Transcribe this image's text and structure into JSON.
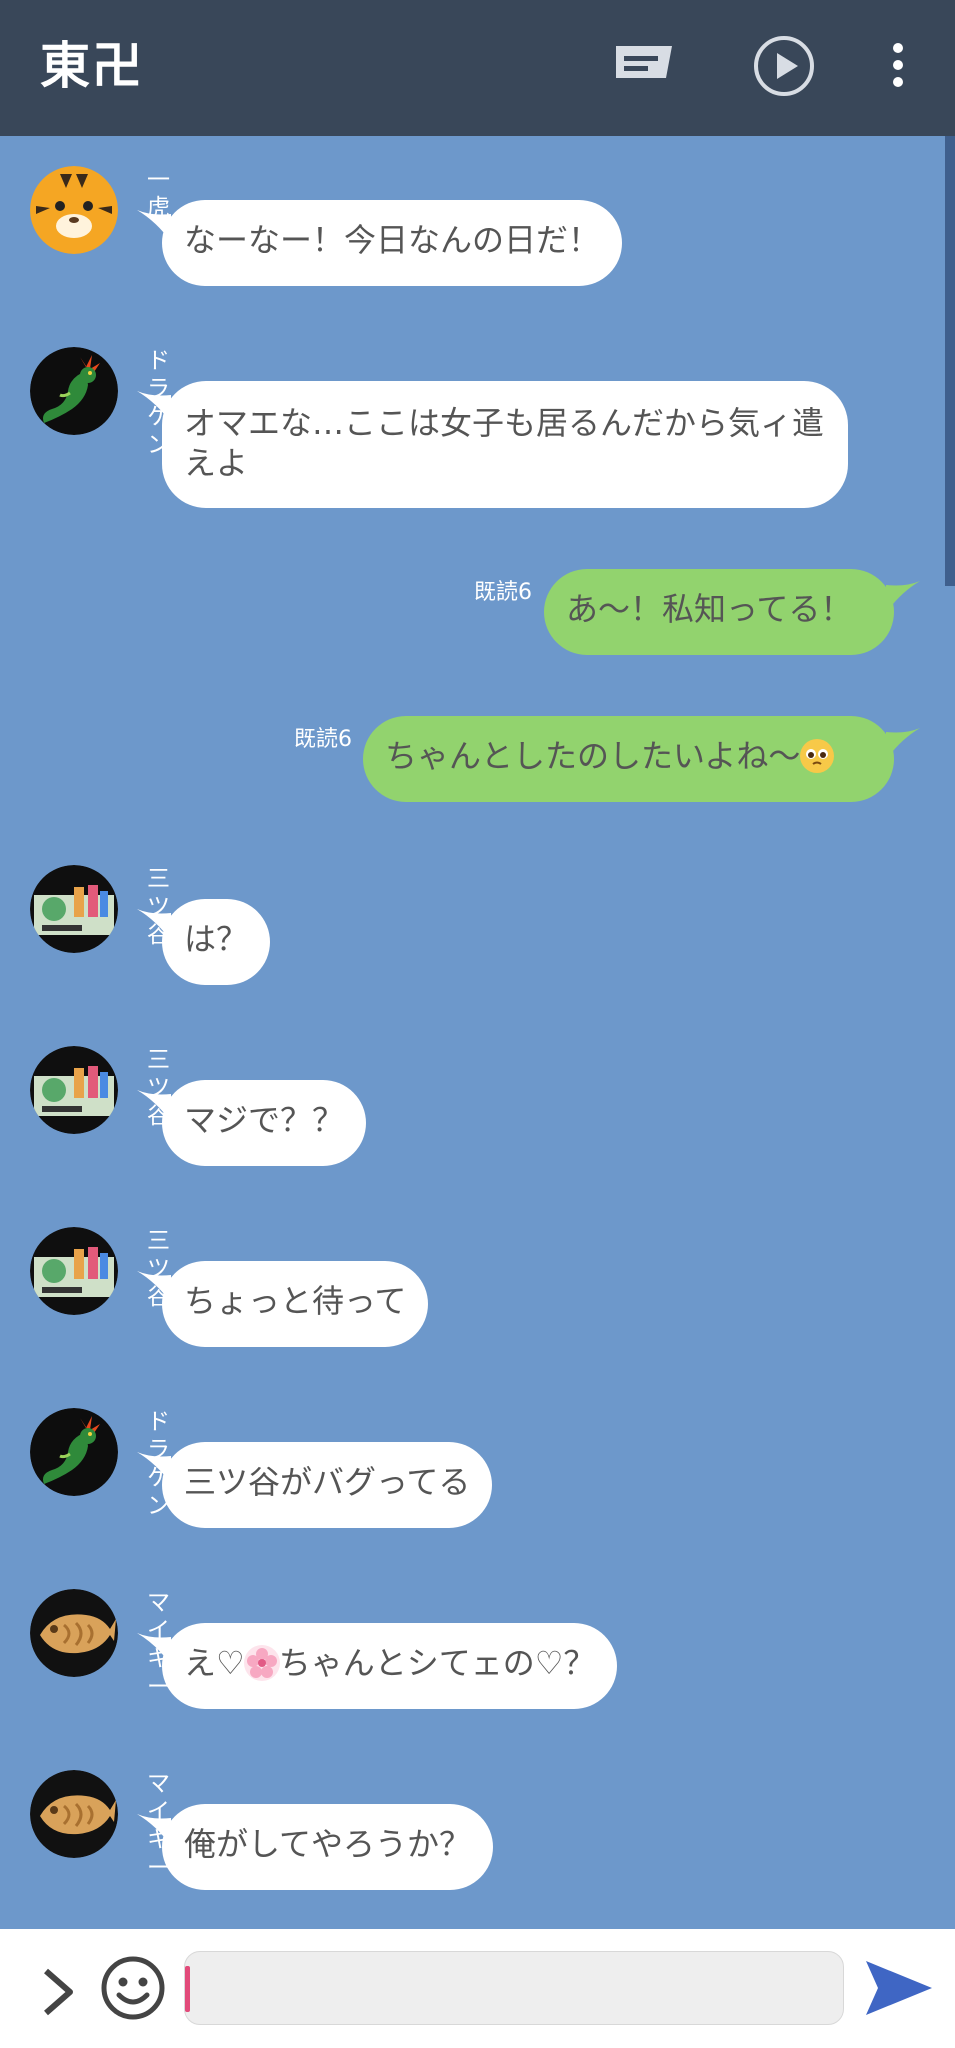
{
  "header": {
    "title": "東卍",
    "icons": [
      "notes-icon",
      "play-icon",
      "more-icon"
    ]
  },
  "messages": [
    {
      "sender": "一虎",
      "text": "なーなー！今日なんの日だ！",
      "avatar": "tiger-avatar"
    },
    {
      "sender": "ドラケン",
      "text": "オマエな…ここは女子も居るんだから気ィ遣えよ",
      "avatar": "dragon-avatar"
    },
    {
      "read": "既読6",
      "text": "あ〜！私知ってる！"
    },
    {
      "read": "既読6",
      "text": "ちゃんとしたのしたいよね〜",
      "emoji": "pleading-face-emoji"
    },
    {
      "sender": "三ツ谷",
      "text": "は？",
      "avatar": "sewing-avatar"
    },
    {
      "sender": "三ツ谷",
      "text": "マジで？？",
      "avatar": "sewing-avatar"
    },
    {
      "sender": "三ツ谷",
      "text": "ちょっと待って",
      "avatar": "sewing-avatar"
    },
    {
      "sender": "ドラケン",
      "text": "三ツ谷がバグってる",
      "avatar": "dragon-avatar"
    },
    {
      "sender": "マイキー",
      "text_a": "え♡",
      "text_b": "ちゃんとシてェの♡？",
      "emoji": "cherry-blossom-emoji",
      "avatar": "taiyaki-avatar"
    },
    {
      "sender": "マイキー",
      "text": "俺がしてやろうか？",
      "avatar": "taiyaki-avatar"
    }
  ],
  "footer": {
    "input_value": "",
    "icons": [
      "expand-icon",
      "emoji-icon",
      "send-icon"
    ]
  },
  "colors": {
    "header_bg": "#394759",
    "chat_bg": "#6d98cb",
    "incoming_bubble": "#ffffff",
    "outgoing_bubble": "#92d36e",
    "send_icon": "#3f66c4"
  }
}
